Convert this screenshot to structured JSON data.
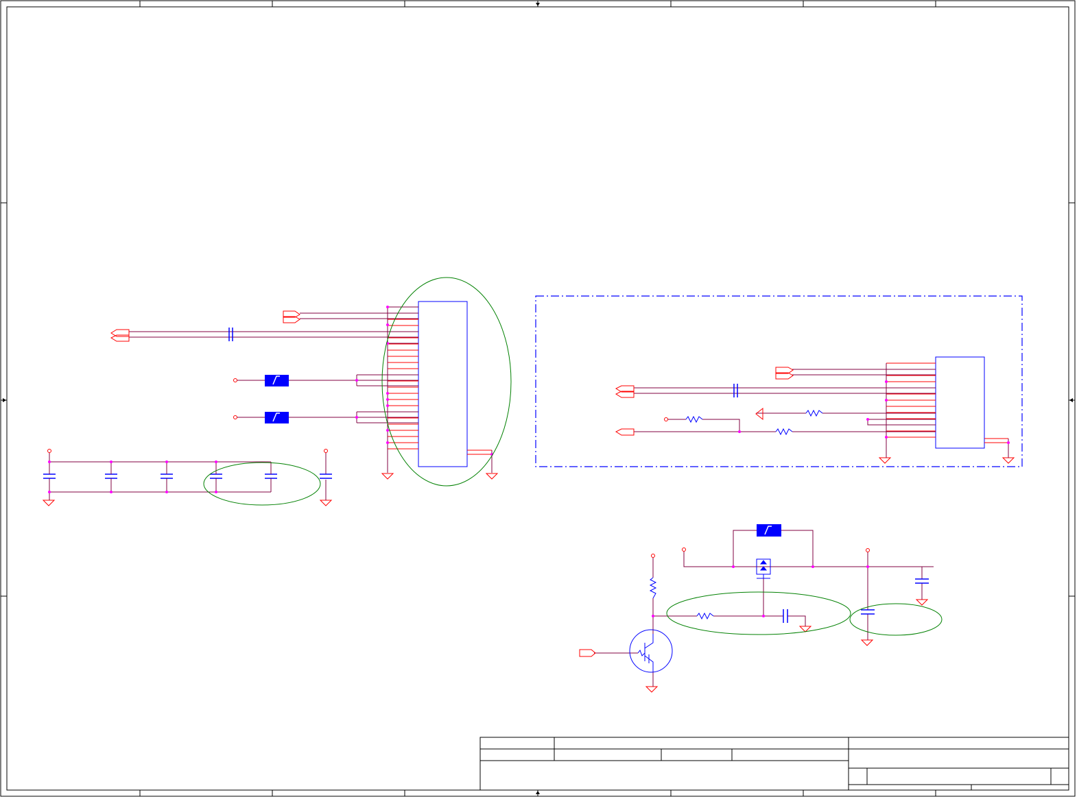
{
  "sheet": {
    "background": "#ffffff",
    "title_block_fields": [
      "",
      "",
      "",
      "",
      "",
      "",
      "",
      ""
    ]
  },
  "colors": {
    "frame": "#000000",
    "wire": "#800040",
    "part": "#0000ff",
    "pin": "#ff0000",
    "junction": "#ff00ff",
    "highlight": "#008000",
    "region": "#0000ff"
  },
  "icons": {
    "port": "pentagon-port-icon",
    "ground": "ground-triangle-icon",
    "power": "power-circle-icon",
    "capacitor": "capacitor-icon",
    "resistor": "resistor-icon",
    "ferrite": "ferrite-bead-icon",
    "transistor": "npn-digital-transistor-icon",
    "fet": "mosfet-icon"
  },
  "components": {
    "connector_main_pins": 24,
    "connector_sub_pins": 13,
    "decoupling_caps": 6,
    "highlight_ellipses": 4
  }
}
